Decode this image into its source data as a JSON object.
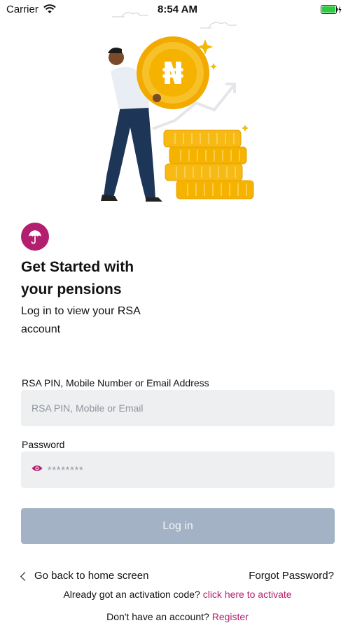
{
  "status_bar": {
    "carrier": "Carrier",
    "time": "8:54 AM",
    "icons": [
      "wifi-icon",
      "battery-charging-icon"
    ]
  },
  "hero": {
    "illustration": "man-carrying-naira-coin-illustration",
    "coin_symbol": "₦"
  },
  "brand": {
    "icon": "umbrella-icon",
    "color": "#b31e6e"
  },
  "intro": {
    "title_line1": "Get Started with",
    "title_line2": "your pensions",
    "subtitle_line1": "Log in to view your RSA",
    "subtitle_line2": "account"
  },
  "form": {
    "id_label": "RSA PIN, Mobile Number or Email Address",
    "id_placeholder": "RSA PIN, Mobile or Email",
    "password_label": "Password",
    "password_placeholder": "********",
    "login_label": "Log in"
  },
  "links": {
    "back_label": "Go back to home screen",
    "forgot_label": "Forgot Password?",
    "activation_prompt": "Already got an activation code?",
    "activation_link": "click here to activate",
    "register_prompt": "Don't have an account?",
    "register_link": "Register"
  },
  "colors": {
    "accent": "#b31e6e",
    "input_bg": "#edeff1",
    "button_disabled": "#a3b2c4",
    "coin": "#f5b800"
  }
}
